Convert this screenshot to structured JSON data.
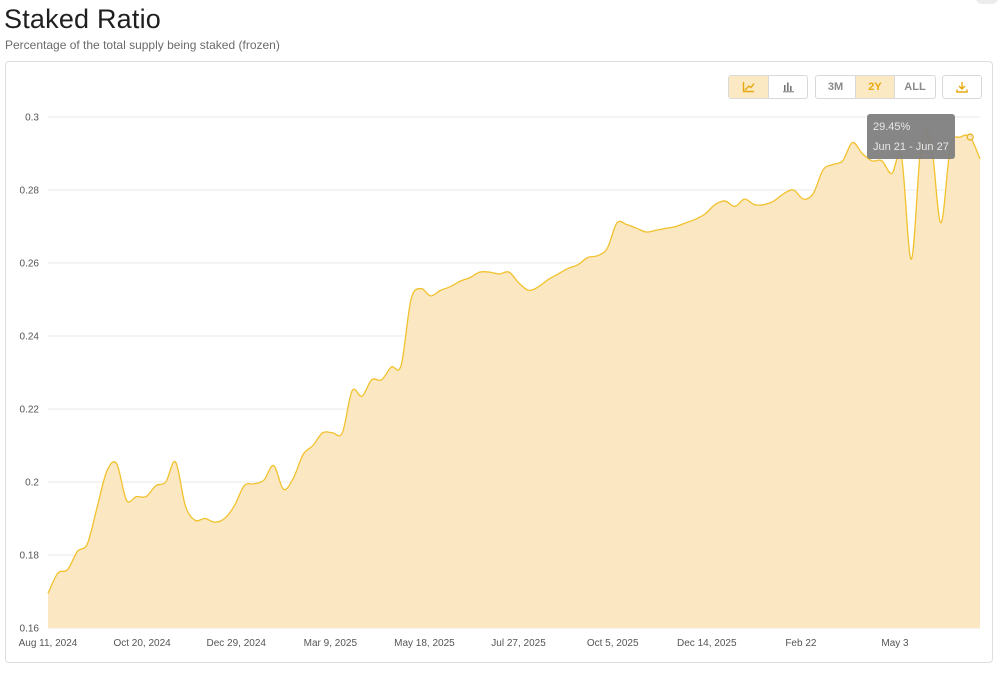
{
  "header": {
    "title": "Staked Ratio",
    "subtitle": "Percentage of the total supply being staked (frozen)"
  },
  "toolbar": {
    "chart_type_buttons": [
      {
        "icon": "line-chart-icon",
        "active": true
      },
      {
        "icon": "bar-chart-icon",
        "active": false
      }
    ],
    "range_buttons": [
      {
        "label": "3M",
        "active": false
      },
      {
        "label": "2Y",
        "active": true
      },
      {
        "label": "ALL",
        "active": false
      }
    ],
    "download_icon": "download-icon"
  },
  "colors": {
    "line": "#f2c12e",
    "fill": "#fbe8c2",
    "grid": "#e9e9e9",
    "accent": "#e8a910",
    "tooltip_bg": "#808080"
  },
  "tooltip": {
    "value": "29.45%",
    "range": "Jun 21 - Jun 27"
  },
  "chart_data": {
    "type": "area",
    "title": "Staked Ratio",
    "xlabel": "",
    "ylabel": "",
    "ylim": [
      0.16,
      0.3
    ],
    "yticks": [
      0.16,
      0.18,
      0.2,
      0.22,
      0.24,
      0.26,
      0.28,
      0.3
    ],
    "ytick_labels": [
      "0.16",
      "0.18",
      "0.2",
      "0.22",
      "0.24",
      "0.26",
      "0.28",
      "0.3"
    ],
    "xticks": [
      "Aug 11, 2024",
      "Oct 20, 2024",
      "Dec 29, 2024",
      "Mar 9, 2025",
      "May 18, 2025",
      "Jul 27, 2025",
      "Oct 5, 2025",
      "Dec 14, 2025",
      "Feb 22",
      "May 3"
    ],
    "grid": true,
    "legend": "none",
    "series": [
      {
        "values": [
          0.1695,
          0.175,
          0.176,
          0.181,
          0.183,
          0.193,
          0.203,
          0.205,
          0.195,
          0.196,
          0.196,
          0.199,
          0.2,
          0.2055,
          0.1935,
          0.1895,
          0.19,
          0.189,
          0.19,
          0.1935,
          0.199,
          0.1995,
          0.2005,
          0.2045,
          0.198,
          0.201,
          0.2075,
          0.21,
          0.2135,
          0.2135,
          0.2135,
          0.225,
          0.2235,
          0.228,
          0.228,
          0.2315,
          0.232,
          0.25,
          0.253,
          0.251,
          0.2525,
          0.2535,
          0.255,
          0.256,
          0.2575,
          0.2575,
          0.257,
          0.2575,
          0.2545,
          0.2525,
          0.2535,
          0.2555,
          0.257,
          0.2585,
          0.2595,
          0.2615,
          0.262,
          0.264,
          0.271,
          0.2705,
          0.2695,
          0.2685,
          0.269,
          0.2695,
          0.27,
          0.271,
          0.272,
          0.2735,
          0.276,
          0.277,
          0.2755,
          0.2775,
          0.276,
          0.276,
          0.277,
          0.279,
          0.28,
          0.2775,
          0.279,
          0.2855,
          0.287,
          0.288,
          0.293,
          0.29,
          0.288,
          0.288,
          0.2845,
          0.289,
          0.261,
          0.2925,
          0.2935,
          0.271,
          0.292,
          0.2945,
          0.2945,
          0.2885
        ]
      }
    ]
  }
}
